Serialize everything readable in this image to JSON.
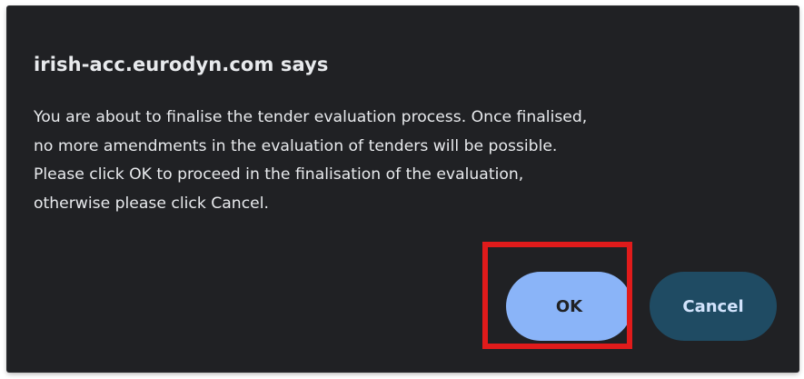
{
  "dialog": {
    "title": "irish-acc.eurodyn.com says",
    "message_lines": [
      "You are about to finalise the tender evaluation process. Once finalised,",
      "no more amendments in the evaluation of tenders will be possible.",
      "Please click OK to proceed in the finalisation of the evaluation,",
      "otherwise please click Cancel."
    ],
    "ok_label": "OK",
    "cancel_label": "Cancel"
  },
  "colors": {
    "dialog_background": "#202124",
    "text": "#e8eaed",
    "ok_button": "#8ab4f8",
    "cancel_button": "#1f4b63",
    "highlight": "#e01b1b"
  }
}
